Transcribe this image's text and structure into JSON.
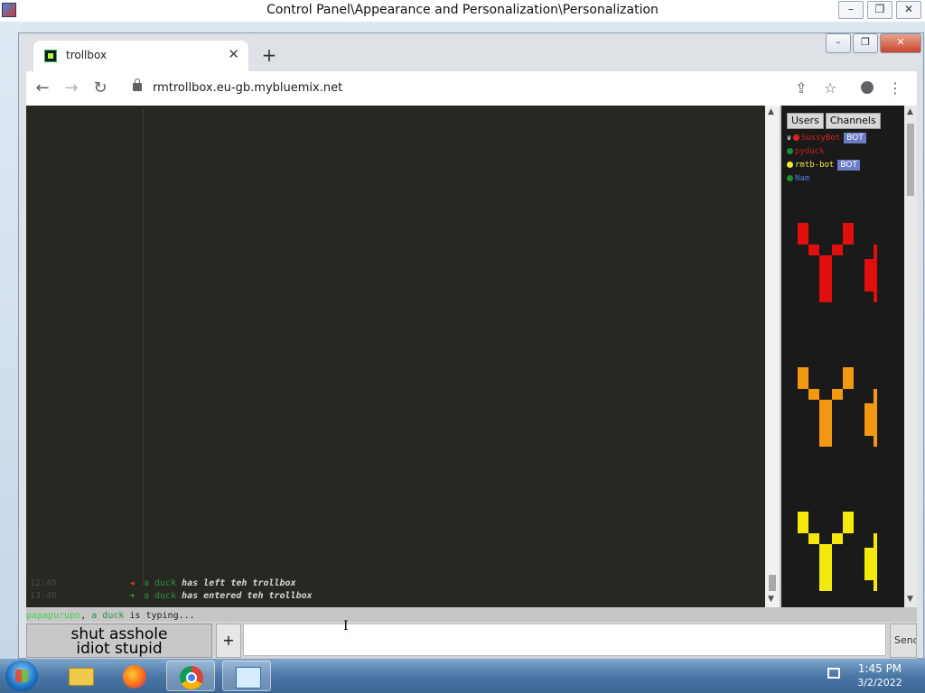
{
  "outer_window": {
    "title": "Control Panel\\Appearance and Personalization\\Personalization"
  },
  "browser": {
    "tab_title": "trollbox",
    "tab_close": "✕",
    "new_tab": "+",
    "url": "rmtrollbox.eu-gb.mybluemix.net"
  },
  "chat": {
    "messages": [
      {
        "time": "12:45",
        "arrow": "◄",
        "nick": "a duck",
        "text": "has left teh trollbox"
      },
      {
        "time": "13:46",
        "arrow": "➔",
        "nick": "a duck",
        "text": "has entered teh trollbox"
      }
    ],
    "typing": {
      "nick1": "papapurupo",
      "sep": ", ",
      "nick2": "a duck",
      "text": " is typing..."
    }
  },
  "sidebar": {
    "tabs": [
      "Users",
      "Channels"
    ],
    "users": [
      {
        "name": "SussyBot",
        "color": "#e02020",
        "dot": "#e02020",
        "owner": true,
        "bot": "BOT"
      },
      {
        "name": "pyduck",
        "color": "#c51f1f",
        "dot": "#1f8f2f",
        "owner": false,
        "bot": ""
      },
      {
        "name": "rmtb-bot",
        "color": "#f2e640",
        "dot": "#f2e640",
        "owner": false,
        "bot": "BOT"
      },
      {
        "name": "Nam",
        "color": "#4a7ad8",
        "dot": "#1f8f2f",
        "owner": false,
        "bot": ""
      }
    ],
    "graphics_colors": [
      "#e10e0e",
      "#f29812",
      "#f5e90c"
    ]
  },
  "composer": {
    "image_button_text_line1": "shut asshole",
    "image_button_text_line2": "idiot stupid",
    "plus": "+",
    "send": "Send"
  },
  "taskbar": {
    "time": "1:45 PM",
    "date": "3/2/2022"
  }
}
